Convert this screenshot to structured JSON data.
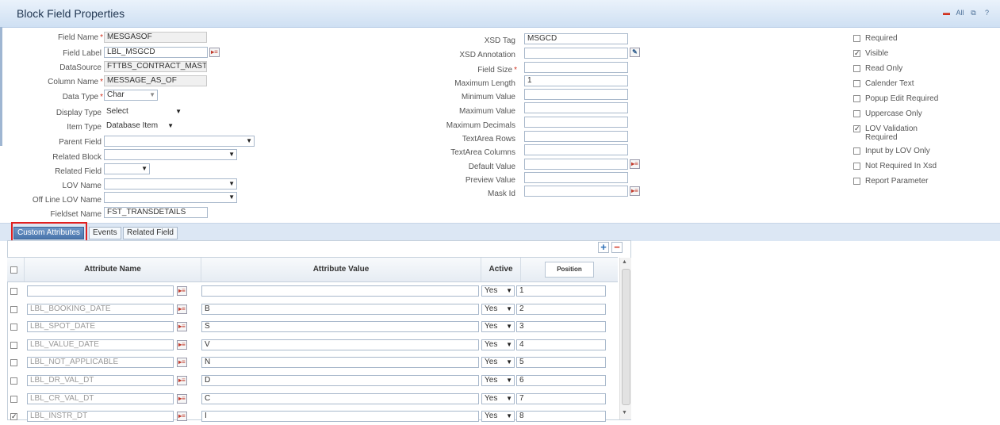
{
  "window": {
    "title": "Block Field Properties",
    "controls": [
      "minimize-icon",
      "all-icon",
      "restore-icon",
      "help-icon"
    ],
    "control_labels": [
      "▬",
      "All",
      "⧉",
      "?"
    ]
  },
  "left_form": {
    "field_name": {
      "label": "Field Name",
      "value": "MESGASOF",
      "required": "*"
    },
    "field_label": {
      "label": "Field Label",
      "value": "LBL_MSGCD"
    },
    "datasource": {
      "label": "DataSource",
      "value": "FTTBS_CONTRACT_MASTE"
    },
    "column_name": {
      "label": "Column Name",
      "value": "MESSAGE_AS_OF",
      "required": "*"
    },
    "data_type": {
      "label": "Data Type",
      "value": "Char",
      "required": "*"
    },
    "display_type": {
      "label": "Display Type",
      "value": "Select"
    },
    "item_type": {
      "label": "Item Type",
      "value": "Database Item"
    },
    "parent_field": {
      "label": "Parent Field",
      "value": ""
    },
    "related_block": {
      "label": "Related Block",
      "value": ""
    },
    "related_field": {
      "label": "Related Field",
      "value": ""
    },
    "lov_name": {
      "label": "LOV Name",
      "value": ""
    },
    "offline_lov_name": {
      "label": "Off Line LOV Name",
      "value": ""
    },
    "fieldset_name": {
      "label": "Fieldset Name",
      "value": "FST_TRANSDETAILS"
    }
  },
  "middle_form": {
    "xsd_tag": {
      "label": "XSD Tag",
      "value": "MSGCD"
    },
    "xsd_annotation": {
      "label": "XSD Annotation",
      "value": ""
    },
    "field_size": {
      "label": "Field Size",
      "value": "",
      "required": "*"
    },
    "maximum_length": {
      "label": "Maximum Length",
      "value": "1"
    },
    "minimum_value": {
      "label": "Minimum Value",
      "value": ""
    },
    "maximum_value": {
      "label": "Maximum Value",
      "value": ""
    },
    "maximum_decimals": {
      "label": "Maximum Decimals",
      "value": ""
    },
    "textarea_rows": {
      "label": "TextArea Rows",
      "value": ""
    },
    "textarea_columns": {
      "label": "TextArea Columns",
      "value": ""
    },
    "default_value": {
      "label": "Default Value",
      "value": ""
    },
    "preview_value": {
      "label": "Preview Value",
      "value": ""
    },
    "mask_id": {
      "label": "Mask Id",
      "value": ""
    }
  },
  "checkboxes": [
    {
      "label": "Required",
      "checked": false
    },
    {
      "label": "Visible",
      "checked": true
    },
    {
      "label": "Read Only",
      "checked": false
    },
    {
      "label": "Calender Text",
      "checked": false
    },
    {
      "label": "Popup Edit Required",
      "checked": false
    },
    {
      "label": "Uppercase Only",
      "checked": false
    },
    {
      "label": "LOV Validation Required",
      "checked": true
    },
    {
      "label": "Input by LOV Only",
      "checked": false
    },
    {
      "label": "Not Required In Xsd",
      "checked": false
    },
    {
      "label": "Report Parameter",
      "checked": false
    }
  ],
  "tabs": [
    {
      "label": "Custom Attributes",
      "active": true
    },
    {
      "label": "Events",
      "active": false
    },
    {
      "label": "Related Field",
      "active": false
    }
  ],
  "grid": {
    "add_label": "+",
    "remove_label": "−",
    "headers": {
      "name": "Attribute Name",
      "value": "Attribute Value",
      "active": "Active",
      "position": "Position"
    },
    "rows": [
      {
        "checked": false,
        "name": "",
        "value": "",
        "active": "Yes",
        "position": "1"
      },
      {
        "checked": false,
        "name": "LBL_BOOKING_DATE",
        "value": "B",
        "active": "Yes",
        "position": "2"
      },
      {
        "checked": false,
        "name": "LBL_SPOT_DATE",
        "value": "S",
        "active": "Yes",
        "position": "3"
      },
      {
        "checked": false,
        "name": "LBL_VALUE_DATE",
        "value": "V",
        "active": "Yes",
        "position": "4"
      },
      {
        "checked": false,
        "name": "LBL_NOT_APPLICABLE",
        "value": "N",
        "active": "Yes",
        "position": "5"
      },
      {
        "checked": false,
        "name": "LBL_DR_VAL_DT",
        "value": "D",
        "active": "Yes",
        "position": "6"
      },
      {
        "checked": false,
        "name": "LBL_CR_VAL_DT",
        "value": "C",
        "active": "Yes",
        "position": "7"
      },
      {
        "checked": true,
        "name": "LBL_INSTR_DT",
        "value": "I",
        "active": "Yes",
        "position": "8"
      }
    ]
  },
  "colors": {
    "accent": "#4a76ad",
    "required": "#d0311f",
    "highlight": "#e02020"
  }
}
